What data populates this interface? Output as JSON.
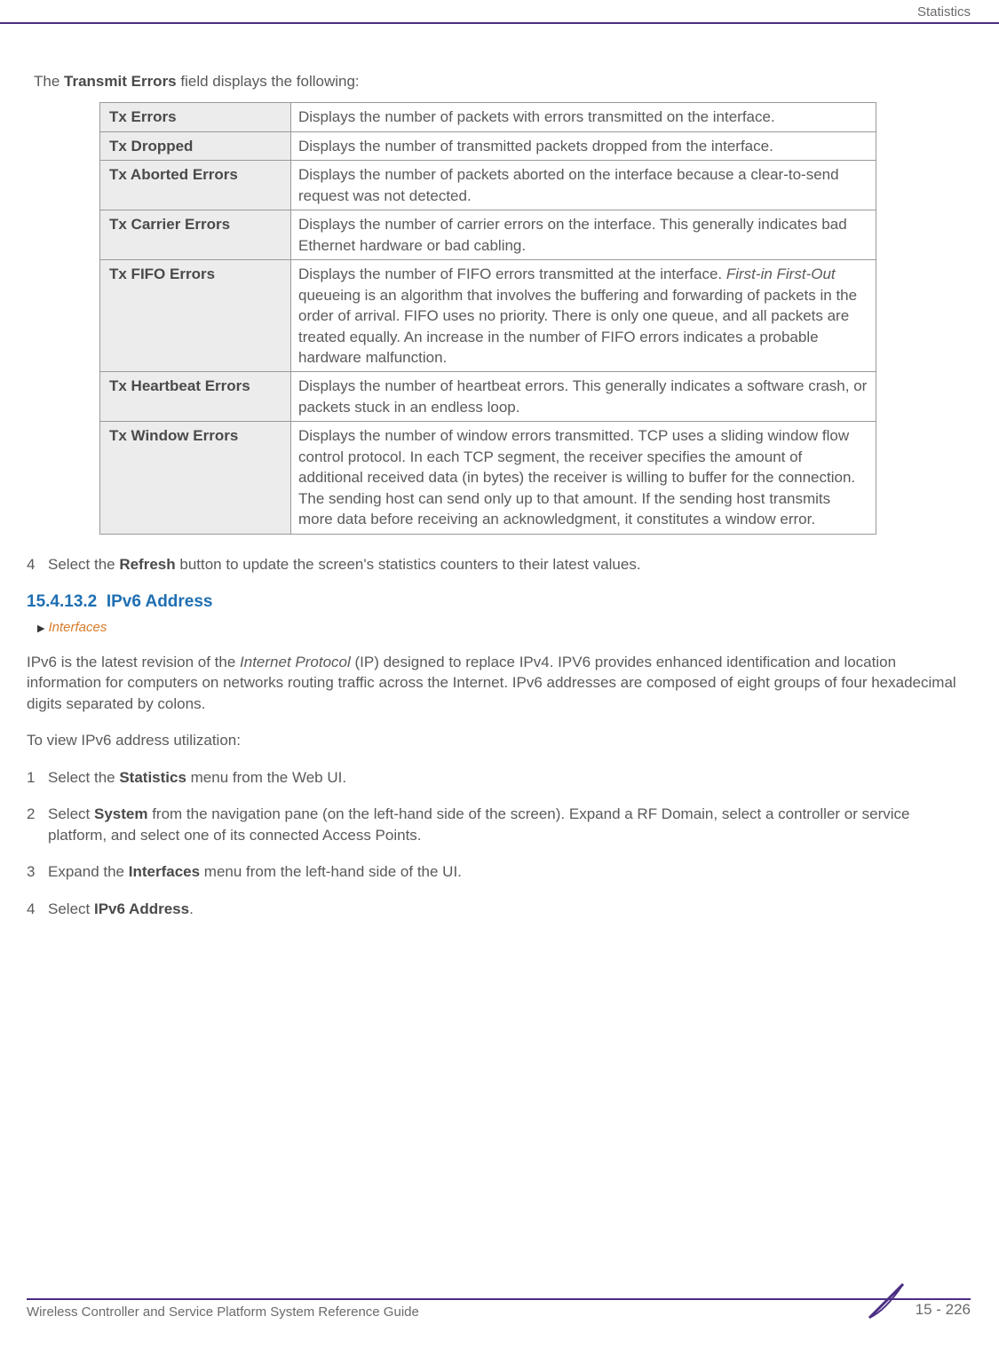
{
  "header": {
    "category": "Statistics"
  },
  "intro": {
    "prefix": "The ",
    "boldField": "Transmit Errors",
    "suffix": " field displays the following:"
  },
  "table": {
    "rows": [
      {
        "label": "Tx Errors",
        "desc": "Displays the number of packets with errors transmitted on the interface."
      },
      {
        "label": "Tx Dropped",
        "desc": "Displays the number of transmitted packets dropped from the interface."
      },
      {
        "label": "Tx Aborted Errors",
        "desc": "Displays the number of packets aborted on the interface because a clear-to-send request was not detected."
      },
      {
        "label": "Tx Carrier Errors",
        "desc": "Displays the number of carrier errors on the interface. This generally indicates bad Ethernet hardware or bad cabling."
      },
      {
        "label": "Tx FIFO Errors",
        "desc_pre": "Displays the number of FIFO errors transmitted at the interface. ",
        "desc_ital": "First-in First-Out",
        "desc_post": " queueing is an algorithm that involves the buffering and forwarding of packets in the order of arrival. FIFO uses no priority. There is only one queue, and all packets are treated equally. An increase in the number of FIFO errors indicates a probable hardware malfunction."
      },
      {
        "label": "Tx Heartbeat Errors",
        "desc": "Displays the number of heartbeat errors. This generally indicates a software crash, or packets stuck in an endless loop."
      },
      {
        "label": "Tx Window Errors",
        "desc": "Displays the number of window errors transmitted. TCP uses a sliding window flow control protocol. In each TCP segment, the receiver specifies the amount of additional received data (in bytes) the receiver is willing to buffer for the connection. The sending host can send only up to that amount. If the sending host transmits more data before receiving an acknowledgment, it constitutes a window error."
      }
    ]
  },
  "afterTableStep": {
    "num": "4",
    "pre": "Select the ",
    "bold": "Refresh",
    "post": " button to update the screen's statistics counters to their latest values."
  },
  "section": {
    "number": "15.4.13.2",
    "title": "IPv6 Address",
    "breadcrumb": "Interfaces"
  },
  "paragraph1": {
    "pre": "IPv6 is the latest revision of the ",
    "ital": "Internet Protocol",
    "post": " (IP) designed to replace IPv4. IPV6 provides enhanced identification and location information for computers on networks routing traffic across the Internet. IPv6 addresses are composed of eight groups of four hexadecimal digits separated by colons."
  },
  "paragraph2": "To view IPv6 address utilization:",
  "steps": [
    {
      "num": "1",
      "pre": "Select the ",
      "bold": "Statistics",
      "post": " menu from the Web UI."
    },
    {
      "num": "2",
      "pre": "Select ",
      "bold": "System",
      "post": " from the navigation pane (on the left-hand side of the screen). Expand a RF Domain, select a controller or service platform, and select one of its connected Access Points."
    },
    {
      "num": "3",
      "pre": "Expand the ",
      "bold": "Interfaces",
      "post": " menu from the left-hand side of the UI."
    },
    {
      "num": "4",
      "pre": "Select ",
      "bold": "IPv6 Address",
      "post": "."
    }
  ],
  "footer": {
    "title": "Wireless Controller and Service Platform System Reference Guide",
    "page": "15 - 226"
  }
}
